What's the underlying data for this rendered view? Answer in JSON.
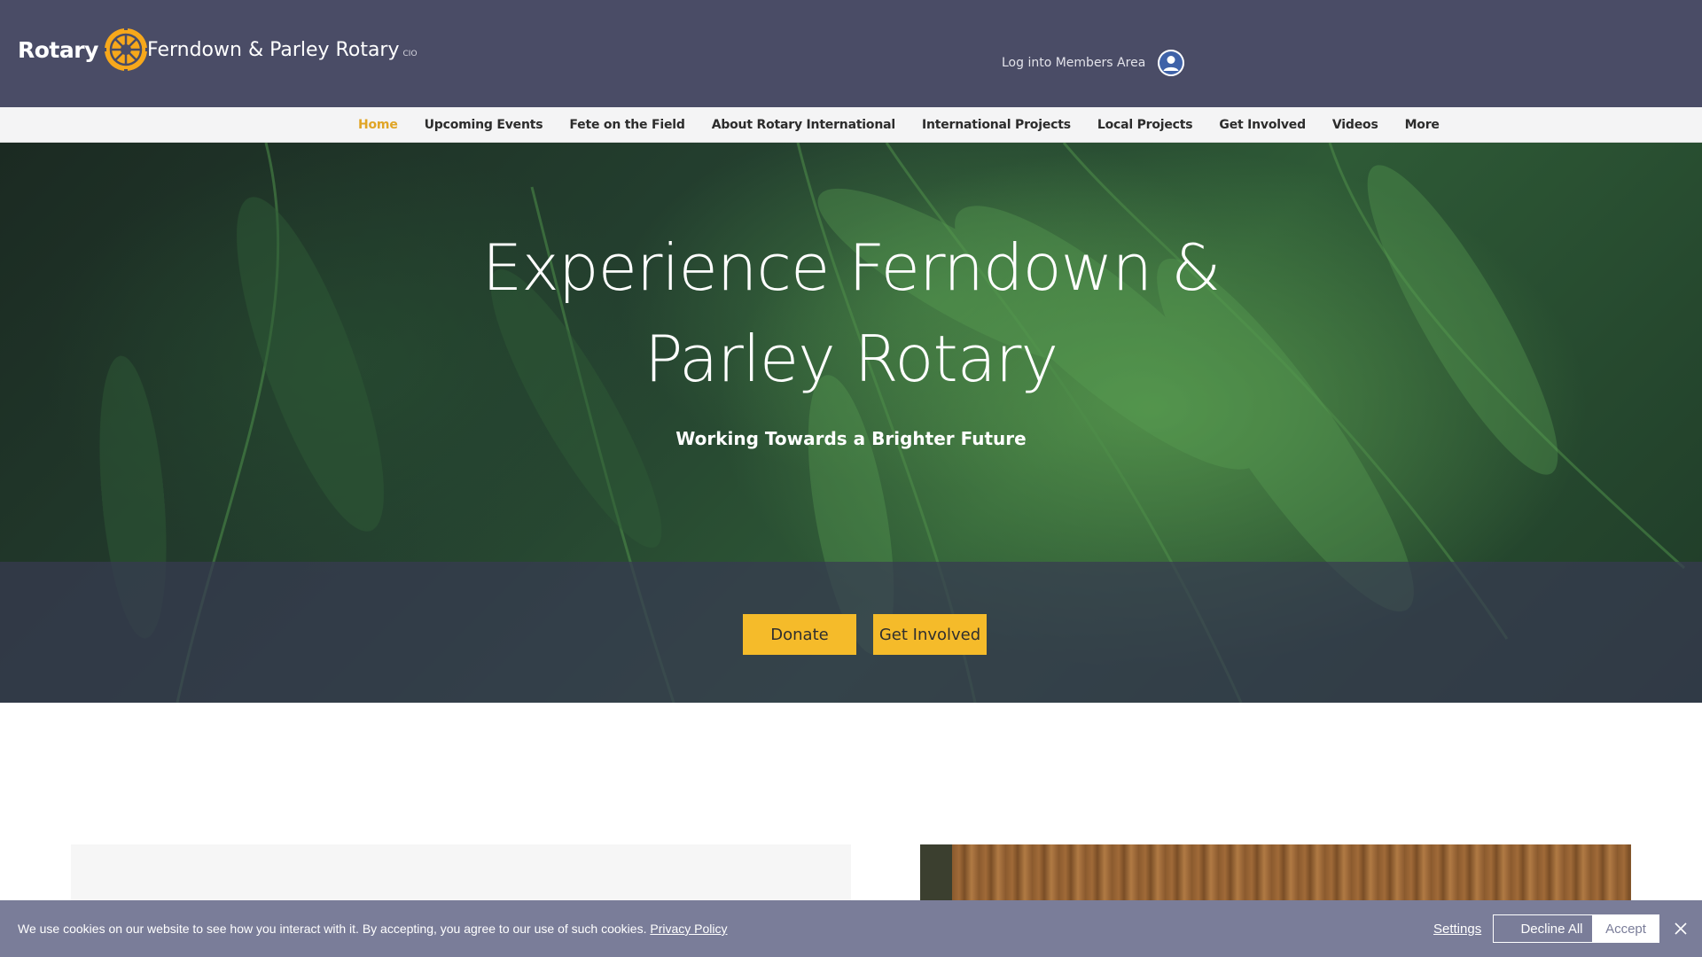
{
  "header": {
    "logo_word": "Rotary",
    "site_title": "Ferndown & Parley Rotary",
    "site_suffix": "CIO",
    "login_label": "Log into Members Area"
  },
  "nav": {
    "items": [
      {
        "label": "Home",
        "active": true
      },
      {
        "label": "Upcoming Events"
      },
      {
        "label": "Fete on the Field"
      },
      {
        "label": "About Rotary International"
      },
      {
        "label": "International Projects"
      },
      {
        "label": "Local Projects"
      },
      {
        "label": "Get Involved"
      },
      {
        "label": "Videos"
      },
      {
        "label": "More"
      }
    ]
  },
  "hero": {
    "title": "Experience Ferndown & Parley Rotary",
    "subtitle": "Working Towards a Brighter Future",
    "donate_label": "Donate",
    "get_involved_label": "Get Involved"
  },
  "cookie": {
    "text": "We use cookies on our website to see how you interact with it. By accepting, you agree to our use of such cookies.",
    "privacy_link": "Privacy Policy",
    "settings_label": "Settings",
    "decline_label": "Decline All",
    "accept_label": "Accept"
  },
  "colors": {
    "header_bg": "#4a4c66",
    "accent": "#f5bb2a",
    "nav_active": "#e0a526",
    "cookie_bg": "#7a7d99"
  },
  "icons": {
    "logo": "rotary-wheel-icon",
    "login": "user-avatar-icon",
    "close": "close-icon"
  }
}
